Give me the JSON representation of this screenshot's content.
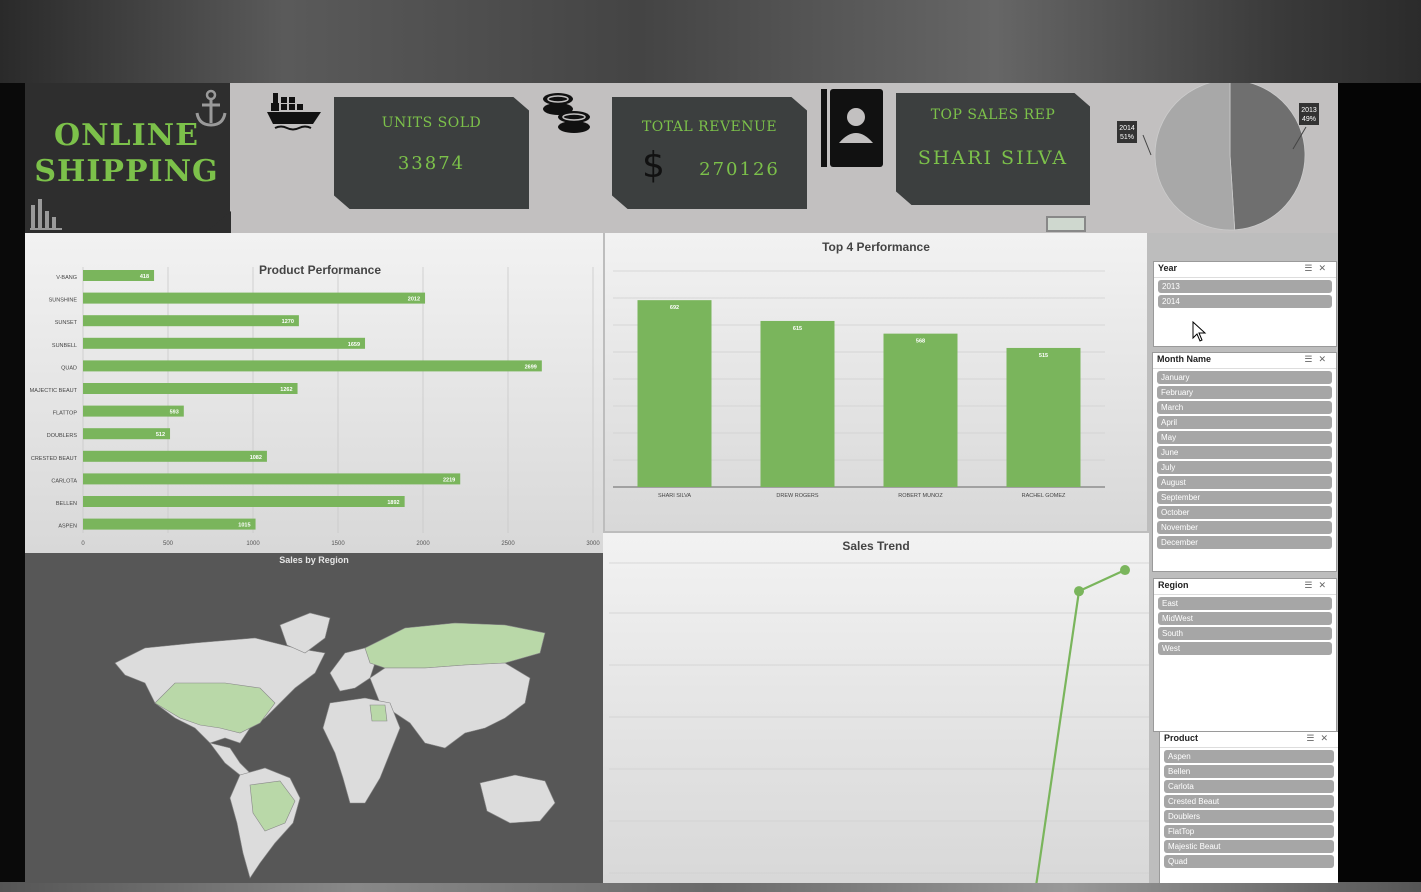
{
  "title": {
    "line1": "ONLINE",
    "line2": "SHIPPING"
  },
  "kpis": {
    "units_sold": {
      "label": "UNITS SOLD",
      "value": "33874"
    },
    "total_revenue": {
      "label": "TOTAL REVENUE",
      "currency": "$",
      "value": "270126"
    },
    "top_rep": {
      "label": "TOP SALES REP",
      "value": "SHARI SILVA"
    }
  },
  "year_pie": {
    "slices": [
      {
        "label": "2013",
        "pct_label": "49%",
        "value": 49,
        "color": "#6f6f6f"
      },
      {
        "label": "2014",
        "pct_label": "51%",
        "value": 51,
        "color": "#a8a8a8"
      }
    ]
  },
  "chart_data": [
    {
      "type": "bar",
      "orientation": "horizontal",
      "title": "Product Performance",
      "categories": [
        "V-BANG",
        "SUNSHINE",
        "SUNSET",
        "SUNBELL",
        "QUAD",
        "MAJECTIC BEAUT",
        "FLATTOP",
        "DOUBLERS",
        "CRESTED BEAUT",
        "CARLOTA",
        "BELLEN",
        "ASPEN"
      ],
      "values": [
        418,
        2012,
        1270,
        1659,
        2699,
        1262,
        593,
        512,
        1082,
        2219,
        1892,
        1015
      ],
      "value_labels": [
        "418",
        "2012",
        "1270",
        "1659",
        "2699",
        "1262",
        "593",
        "512",
        "1082",
        "2219",
        "1892",
        "1015"
      ],
      "xlim": [
        0,
        3000
      ],
      "xticks": [
        "0",
        "500",
        "1000",
        "1500",
        "2000",
        "2500",
        "3000"
      ],
      "color": "#7ab55c"
    },
    {
      "type": "bar",
      "title": "Top 4 Performance",
      "categories": [
        "SHARI SILVA",
        "DREW ROGERS",
        "ROBERT MUNOZ",
        "RACHEL GOMEZ"
      ],
      "values": [
        692,
        615,
        568,
        515
      ],
      "value_labels": [
        "692",
        "615",
        "568",
        "515"
      ],
      "ylim": [
        0,
        800
      ],
      "color": "#7ab55c"
    },
    {
      "type": "line",
      "title": "Sales Trend",
      "points": [
        {
          "x": 0,
          "y": 0
        },
        {
          "x": 1,
          "y": 1
        },
        {
          "x": 2,
          "y": 1.07
        }
      ],
      "color": "#7ab55c"
    }
  ],
  "map": {
    "title": "Sales by Region"
  },
  "slicers": {
    "year": {
      "title": "Year",
      "items": [
        "2013",
        "2014"
      ]
    },
    "month": {
      "title": "Month Name",
      "items": [
        "January",
        "February",
        "March",
        "April",
        "May",
        "June",
        "July",
        "August",
        "September",
        "October",
        "November",
        "December"
      ]
    },
    "region": {
      "title": "Region",
      "items": [
        "East",
        "MidWest",
        "South",
        "West"
      ]
    },
    "product": {
      "title": "Product",
      "items": [
        "Aspen",
        "Bellen",
        "Carlota",
        "Crested Beaut",
        "Doublers",
        "FlatTop",
        "Majestic Beaut",
        "Quad"
      ]
    }
  }
}
